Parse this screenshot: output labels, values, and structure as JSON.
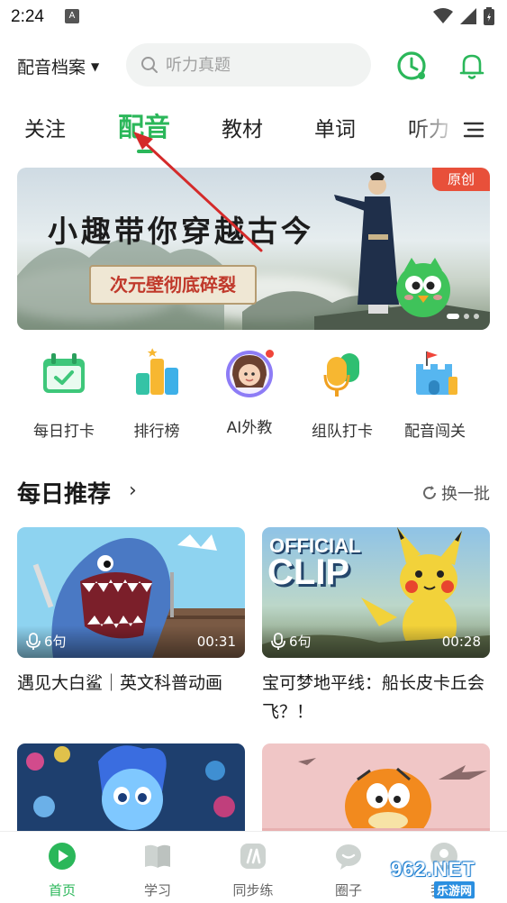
{
  "status_bar": {
    "time": "2:24",
    "app_icon": "A"
  },
  "header": {
    "profile_label": "配音档案",
    "search_placeholder": "听力真题"
  },
  "tabs": [
    {
      "label": "关注"
    },
    {
      "label": "配音",
      "active": true
    },
    {
      "label": "教材"
    },
    {
      "label": "单词"
    },
    {
      "label": "听力"
    }
  ],
  "banner": {
    "title": "小趣带你穿越古今",
    "subtitle": "次元壁彻底碎裂",
    "badge": "原创"
  },
  "quick_entries": [
    {
      "label": "每日打卡",
      "icon": "calendar-check-icon"
    },
    {
      "label": "排行榜",
      "icon": "leaderboard-icon"
    },
    {
      "label": "AI外教",
      "icon": "ai-teacher-avatar-icon",
      "has_dot": true
    },
    {
      "label": "组队打卡",
      "icon": "team-mic-icon"
    },
    {
      "label": "配音闯关",
      "icon": "castle-flag-icon"
    }
  ],
  "recommend": {
    "title": "每日推荐",
    "refresh_label": "换一批",
    "cards": [
      {
        "title": "遇见大白鲨｜英文科普动画",
        "sentences": "6句",
        "duration": "00:31"
      },
      {
        "title": "宝可梦地平线：船长皮卡丘会飞？！",
        "sentences": "6句",
        "duration": "00:28",
        "thumb_text_1": "OFFICIAL",
        "thumb_text_2": "CLIP"
      },
      {
        "title": "",
        "sentences": "",
        "duration": ""
      },
      {
        "title": "",
        "sentences": "",
        "duration": ""
      }
    ]
  },
  "bottom_nav": [
    {
      "label": "首页",
      "active": true
    },
    {
      "label": "学习"
    },
    {
      "label": "同步练"
    },
    {
      "label": "圈子"
    },
    {
      "label": "我的"
    }
  ],
  "watermark": {
    "number": "962.NET",
    "text": "乐游网"
  },
  "colors": {
    "accent": "#2bb75a",
    "badge": "#e8503a",
    "annotation": "#d42a2a"
  }
}
